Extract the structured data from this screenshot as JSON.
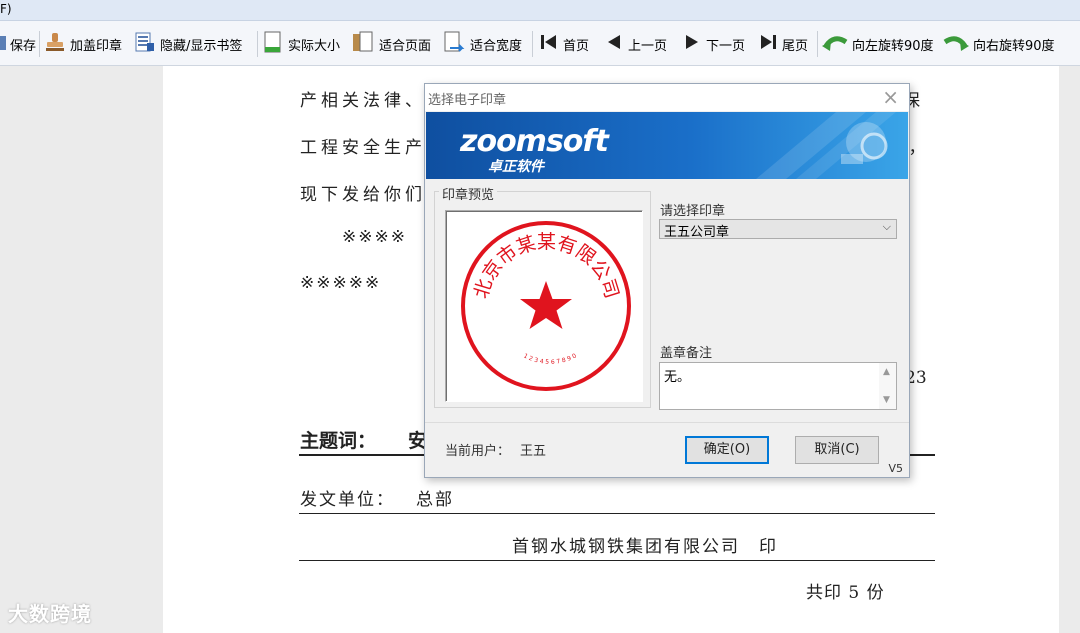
{
  "menu": {
    "partial_label": "F)"
  },
  "toolbar": {
    "items": [
      {
        "label": "保存",
        "icon": "save-icon"
      },
      {
        "label": "加盖印章",
        "icon": "stamp-icon"
      },
      {
        "label": "隐藏/显示书签",
        "icon": "bookmark-icon"
      },
      {
        "label": "实际大小",
        "icon": "actual-size-icon"
      },
      {
        "label": "适合页面",
        "icon": "fit-page-icon"
      },
      {
        "label": "适合宽度",
        "icon": "fit-width-icon"
      },
      {
        "label": "首页",
        "icon": "first-page-icon"
      },
      {
        "label": "上一页",
        "icon": "prev-page-icon"
      },
      {
        "label": "下一页",
        "icon": "next-page-icon"
      },
      {
        "label": "尾页",
        "icon": "last-page-icon"
      },
      {
        "label": "向左旋转90度",
        "icon": "rotate-left-icon"
      },
      {
        "label": "向右旋转90度",
        "icon": "rotate-right-icon"
      }
    ]
  },
  "document": {
    "line1": "产相关法律、",
    "line1_tail": "保",
    "line2": "工程安全生产",
    "line2_tail": "》，",
    "line3": "现下发给你们",
    "line4": "※※※※",
    "line5": "※※※※※",
    "date_tail": "23",
    "subject_label": "主题词：",
    "subject_value": "安",
    "sender_label": "发文单位：",
    "sender_value": "总部",
    "printer": "首钢水城钢铁集团有限公司　印",
    "copies": "共印 5 份"
  },
  "dialog": {
    "title": "选择电子印章",
    "logo_text": "zoomsoft",
    "logo_sub": "卓正软件",
    "preview_legend": "印章预览",
    "seal_text": "北京市某某有限公司",
    "seal_digits": "1 2 3 4 5 6 7 8 9 0",
    "select_label": "请选择印章",
    "select_value": "王五公司章",
    "memo_label": "盖章备注",
    "memo_value": "无。",
    "current_user_label": "当前用户：",
    "current_user": "王五",
    "ok_label": "确定(O)",
    "cancel_label": "取消(C)",
    "version": "V5"
  },
  "watermark": "大数跨境",
  "colors": {
    "seal_red": "#e0141e",
    "banner_blue": "#1a6fc9",
    "primary_border": "#0078d7"
  }
}
